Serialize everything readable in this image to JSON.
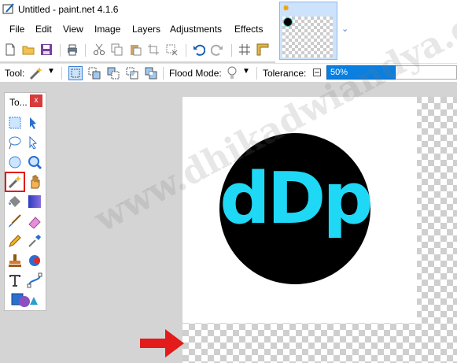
{
  "window": {
    "title": "Untitled - paint.net 4.1.6"
  },
  "menu": [
    "File",
    "Edit",
    "View",
    "Image",
    "Layers",
    "Adjustments",
    "Effects"
  ],
  "toolbar2": {
    "tool_label": "Tool:",
    "flood_mode_label": "Flood Mode:",
    "tolerance_label": "Tolerance:",
    "tolerance_value": "50%",
    "tolerance_fraction": 0.5
  },
  "tools_panel": {
    "title": "To...",
    "close": "x"
  },
  "canvas": {
    "logo_text": "dDp"
  },
  "watermark": "www.dhikadwiandya.com",
  "colors": {
    "accent": "#0a7fe0",
    "logo": "#1fd8f5",
    "highlight": "#e1131d"
  }
}
